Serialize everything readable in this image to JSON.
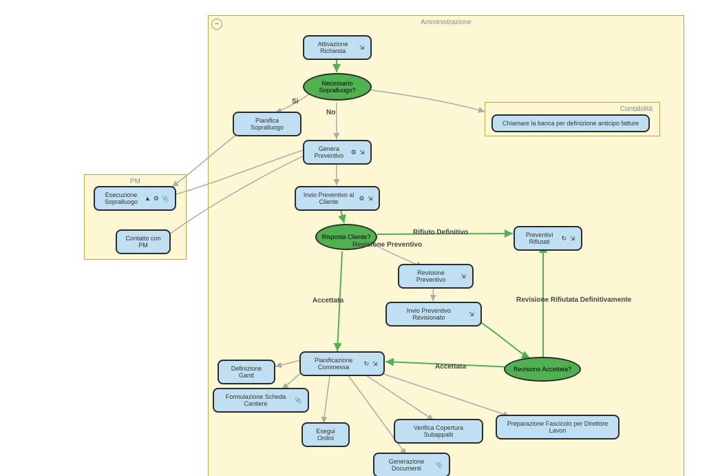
{
  "lanes": {
    "admin": {
      "label": "Amministrazione"
    },
    "pm": {
      "label": "PM"
    },
    "cont": {
      "label": "Contabilità"
    }
  },
  "nodes": {
    "att": {
      "label": "Attivazione Richiesta"
    },
    "nec": {
      "label": "Necessario Sopralluogo?"
    },
    "pian_sop": {
      "label": "Pianifica Sopralluogo"
    },
    "esec_sop": {
      "label": "Esecuzione Sopralluogo"
    },
    "contatto": {
      "label": "Contatto con PM"
    },
    "gen_prev": {
      "label": "Genera Preventivo"
    },
    "invio_prev": {
      "label": "Invio Preventivo al Cliente"
    },
    "risp": {
      "label": "Risposta Cliente?"
    },
    "rev_prev": {
      "label": "Revisione Preventivo"
    },
    "invio_rev": {
      "label": "Invio Preventivo Revisionato"
    },
    "rifiutati": {
      "label": "Preventivi Rifiutati"
    },
    "rev_acc": {
      "label": "Revisione Accettata?"
    },
    "pian_com": {
      "label": "Pianificazione Commessa"
    },
    "def_gantt": {
      "label": "Definizione Gantt"
    },
    "form_sc": {
      "label": "Formulazione Scheda Cantiere"
    },
    "esegui": {
      "label": "Esegui Ordini"
    },
    "gen_doc": {
      "label": "Generazione Documenti"
    },
    "ver_sub": {
      "label": "Verifica Copertura Subappalti"
    },
    "prep_fasc": {
      "label": "Preparazione Fascicolo per Direttore Lavori"
    },
    "banca": {
      "label": "Chiamare la banca per definizione anticipo fatture"
    }
  },
  "edges": {
    "si": "Si",
    "no": "No",
    "rif_def": "Rifiuto Definitivo",
    "rev_prev": "Revisione Preventivo",
    "acc": "Accettata",
    "acc2": "Accettata",
    "rev_rif": "Revisione Rifiutata Definitivamente"
  }
}
